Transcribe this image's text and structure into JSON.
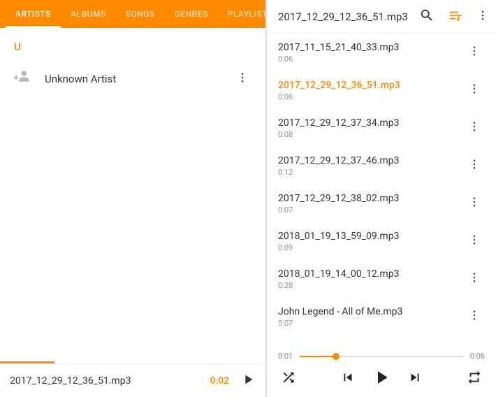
{
  "left": {
    "tabs": [
      "ARTISTS",
      "ALBUMS",
      "SONGS",
      "GENRES",
      "PLAYLISTS"
    ],
    "active_tab": 0,
    "section_letter": "U",
    "artist": "Unknown Artist",
    "mini_title": "2017_12_29_12_36_51.mp3",
    "mini_time": "0:02"
  },
  "right": {
    "header_title": "2017_12_29_12_36_51.mp3",
    "tracks": [
      {
        "title": "2017_11_15_21_40_33.mp3",
        "dur": "0:06",
        "current": false
      },
      {
        "title": "2017_12_29_12_36_51.mp3",
        "dur": "0:06",
        "current": true
      },
      {
        "title": "2017_12_29_12_37_34.mp3",
        "dur": "0:08",
        "current": false
      },
      {
        "title": "2017_12_29_12_37_46.mp3",
        "dur": "0:12",
        "current": false
      },
      {
        "title": "2017_12_29_12_38_02.mp3",
        "dur": "0:07",
        "current": false
      },
      {
        "title": "2018_01_19_13_59_09.mp3",
        "dur": "0:09",
        "current": false
      },
      {
        "title": "2018_01_19_14_00_12.mp3",
        "dur": "0:28",
        "current": false
      },
      {
        "title": "John Legend - All of Me.mp3",
        "dur": "5:07",
        "current": false
      }
    ],
    "elapsed": "0:01",
    "total": "0:06",
    "progress_pct": 22
  }
}
